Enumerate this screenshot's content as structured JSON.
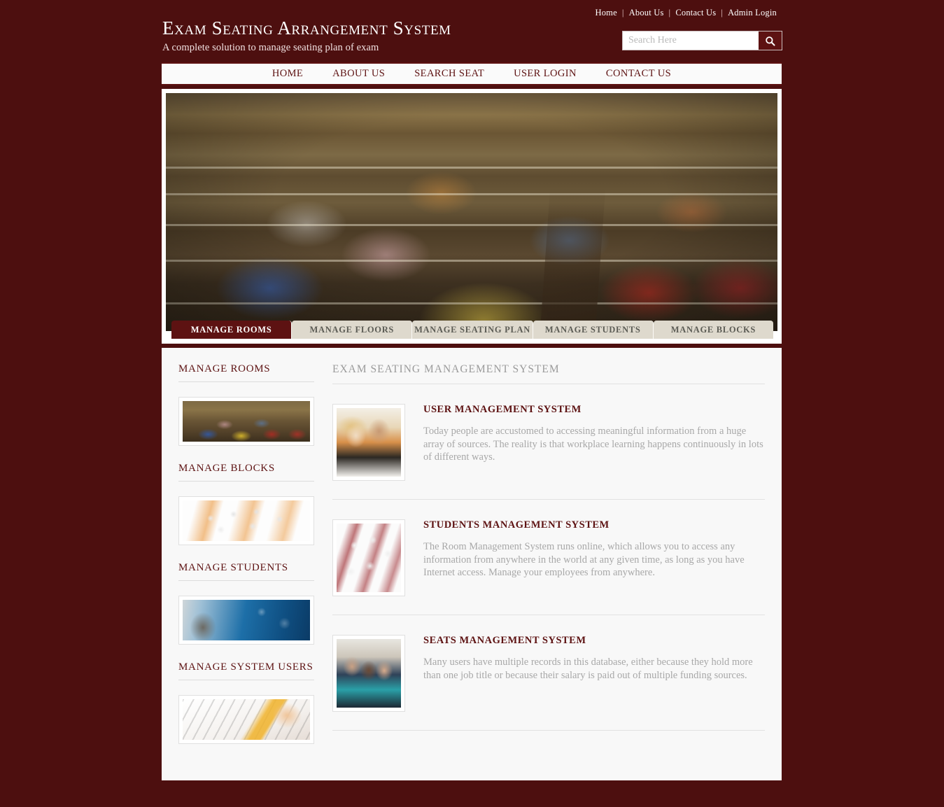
{
  "brand": {
    "title": "Exam Seating Arrangement System",
    "subtitle": "A complete solution to manage seating plan of exam"
  },
  "topbar": {
    "links": [
      {
        "label": "Home"
      },
      {
        "label": "About Us"
      },
      {
        "label": "Contact Us"
      },
      {
        "label": "Admin Login"
      }
    ],
    "separator": "|"
  },
  "search": {
    "placeholder": "Search Here",
    "value": "",
    "icon": "search-icon"
  },
  "mainnav": {
    "items": [
      {
        "label": "HOME"
      },
      {
        "label": "ABOUT US"
      },
      {
        "label": "SEARCH SEAT"
      },
      {
        "label": "USER LOGIN"
      },
      {
        "label": "CONTACT US"
      }
    ]
  },
  "hero": {
    "alt": "exam-hall-photo"
  },
  "tabs": [
    {
      "label": "MANAGE ROOMS",
      "active": true
    },
    {
      "label": "MANAGE FLOORS",
      "active": false
    },
    {
      "label": "MANAGE SEATING PLAN",
      "active": false
    },
    {
      "label": "MANAGE STUDENTS",
      "active": false
    },
    {
      "label": "MANAGE BLOCKS",
      "active": false
    }
  ],
  "sidebar": {
    "sections": [
      {
        "heading": "MANAGE ROOMS",
        "image": "exam-hall-thumbnail"
      },
      {
        "heading": "MANAGE BLOCKS",
        "image": "desks-3d-thumbnail"
      },
      {
        "heading": "MANAGE STUDENTS",
        "image": "student-computer-thumbnail"
      },
      {
        "heading": "MANAGE SYSTEM USERS",
        "image": "answer-sheet-pencil-thumbnail"
      }
    ]
  },
  "main": {
    "heading": "EXAM SEATING MANAGEMENT SYSTEM",
    "features": [
      {
        "title": "USER MANAGEMENT SYSTEM",
        "text": "Today people are accustomed to accessing meaningful information from a huge array of sources. The reality is that workplace learning happens continuously in lots of different ways.",
        "image": "two-people-studying-thumbnail"
      },
      {
        "title": "STUDENTS MANAGEMENT SYSTEM",
        "text": "The Room Management System runs online, which allows you to access any information from anywhere in the world at any given time, as long as you have Internet access. Manage your employees from anywhere.",
        "image": "computer-lab-3d-thumbnail"
      },
      {
        "title": "SEATS MANAGEMENT SYSTEM",
        "text": "Many users have multiple records in this database, either because they hold more than one job title or because their salary is paid out of multiple funding sources.",
        "image": "team-at-computer-thumbnail"
      }
    ]
  },
  "colors": {
    "page_background": "#4d0f0f",
    "accent": "#5d1212",
    "content_background": "#f8f8f8",
    "tab_inactive": "#ded9cd",
    "body_text": "#a8a8a8"
  }
}
